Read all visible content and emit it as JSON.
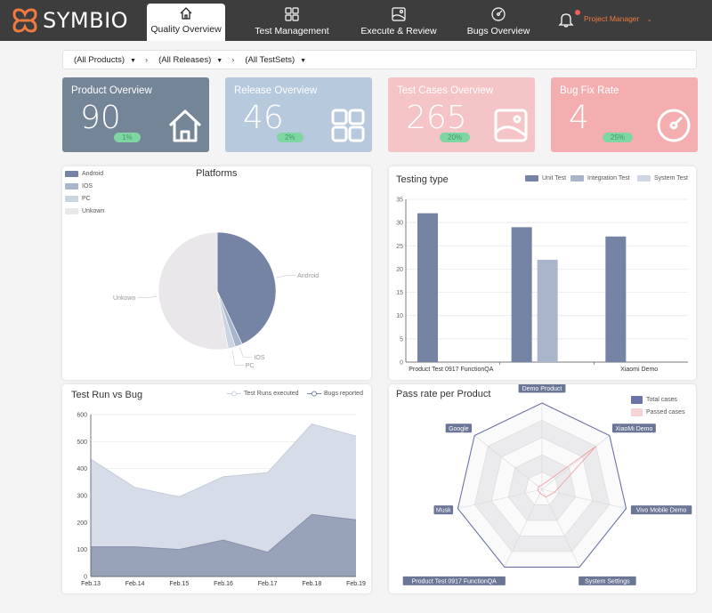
{
  "app": {
    "name": "SYMBIO",
    "role": "Project Manager"
  },
  "nav": [
    {
      "label": "Quality Overview",
      "icon": "home-icon",
      "active": true
    },
    {
      "label": "Test Management",
      "icon": "grid-icon",
      "active": false
    },
    {
      "label": "Execute & Review",
      "icon": "image-icon",
      "active": false
    },
    {
      "label": "Bugs Overview",
      "icon": "gauge-icon",
      "active": false
    }
  ],
  "filters": {
    "products": "(All Products)",
    "releases": "(All Releases)",
    "testsets": "(All TestSets)"
  },
  "cards": [
    {
      "title": "Product Overview",
      "value": "90",
      "pct": "1%",
      "color": "#748598",
      "icon": "house-icon"
    },
    {
      "title": "Release Overview",
      "value": "46",
      "pct": "2%",
      "color": "#b7c9dc",
      "icon": "grid-icon"
    },
    {
      "title": "Test Cases Overview",
      "value": "265",
      "pct": "20%",
      "color": "#f4c4c6",
      "icon": "image-icon"
    },
    {
      "title": "Bug Fix Rate",
      "value": "4",
      "pct": "25%",
      "color": "#f5aeb0",
      "icon": "gauge-icon"
    }
  ],
  "chart_data": [
    {
      "type": "pie",
      "title": "Platforms",
      "legend": [
        "Android",
        "IOS",
        "PC",
        "Unkown"
      ],
      "slices": [
        {
          "name": "Android",
          "value": 43,
          "color": "#7583a4"
        },
        {
          "name": "IOS",
          "value": 2,
          "color": "#a9b5cb"
        },
        {
          "name": "PC",
          "value": 2,
          "color": "#ccd4e1"
        },
        {
          "name": "Unkown",
          "value": 53,
          "color": "#e9e7ea"
        }
      ],
      "legend_placement": "top-left"
    },
    {
      "type": "bar",
      "title": "Testing type",
      "categories": [
        "Product Test 0917 FunctionQA",
        "",
        "Xiaomi Demo"
      ],
      "series": [
        {
          "name": "Unit Test",
          "values": [
            32,
            29,
            27
          ],
          "color": "#7583a4"
        },
        {
          "name": "Integration Test",
          "values": [
            null,
            22,
            null
          ],
          "color": "#a9b5cb"
        },
        {
          "name": "System Test",
          "values": [
            null,
            null,
            null
          ],
          "color": "#cfd7e4"
        }
      ],
      "ylim": [
        0,
        35
      ],
      "yticks": [
        0,
        5,
        10,
        15,
        20,
        25,
        30,
        35
      ],
      "grid": true,
      "legend_placement": "top-right"
    },
    {
      "type": "area",
      "title": "Test Run vs Bug",
      "x": [
        "Feb.13",
        "Feb.14",
        "Feb.15",
        "Feb.16",
        "Feb.17",
        "Feb.18",
        "Feb.19"
      ],
      "series": [
        {
          "name": "Test Runs executed",
          "values": [
            435,
            330,
            295,
            370,
            385,
            565,
            520
          ],
          "color": "#d7dde8"
        },
        {
          "name": "Bugs reported",
          "values": [
            110,
            110,
            100,
            135,
            90,
            230,
            210
          ],
          "color": "#98a3ba"
        }
      ],
      "ylim": [
        0,
        600
      ],
      "yticks": [
        0,
        100,
        200,
        300,
        400,
        500,
        600
      ],
      "grid": true,
      "legend_placement": "top-right"
    },
    {
      "type": "radar",
      "title": "Pass rate per Product",
      "indicators": [
        "Demo Product",
        "XiaoMi Demo",
        "Vivo Mobile Demo",
        "System Settings",
        "Product Test 0917 FunctionQA",
        "Musk",
        "Google"
      ],
      "series": [
        {
          "name": "Total cases",
          "values": [
            100,
            100,
            100,
            100,
            100,
            100,
            100
          ],
          "color": "#6b74a6"
        },
        {
          "name": "Passed cases",
          "values": [
            5,
            80,
            15,
            10,
            5,
            5,
            5
          ],
          "color": "#f2b9bd"
        }
      ],
      "legend_placement": "top-right"
    }
  ]
}
